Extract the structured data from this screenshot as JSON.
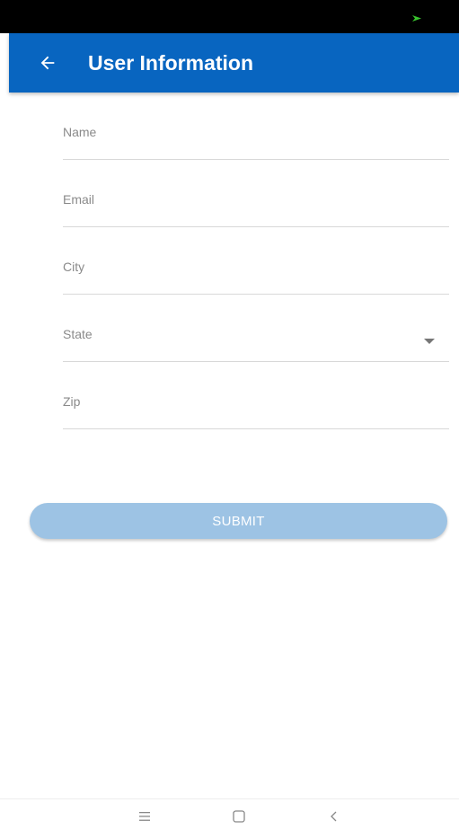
{
  "app_bar": {
    "title": "User Information",
    "color": "#0865c0"
  },
  "status_bar": {
    "indicator_color": "#39c52e"
  },
  "form": {
    "fields": [
      {
        "label": "Name",
        "value": ""
      },
      {
        "label": "Email",
        "value": ""
      },
      {
        "label": "City",
        "value": ""
      },
      {
        "label": "State",
        "value": "",
        "type": "dropdown"
      },
      {
        "label": "Zip",
        "value": ""
      }
    ],
    "submit_label": "SUBMIT",
    "submit_color": "#9dc3e4"
  },
  "nav_bar": {
    "icons": [
      "menu-icon",
      "home-icon",
      "back-icon"
    ]
  }
}
